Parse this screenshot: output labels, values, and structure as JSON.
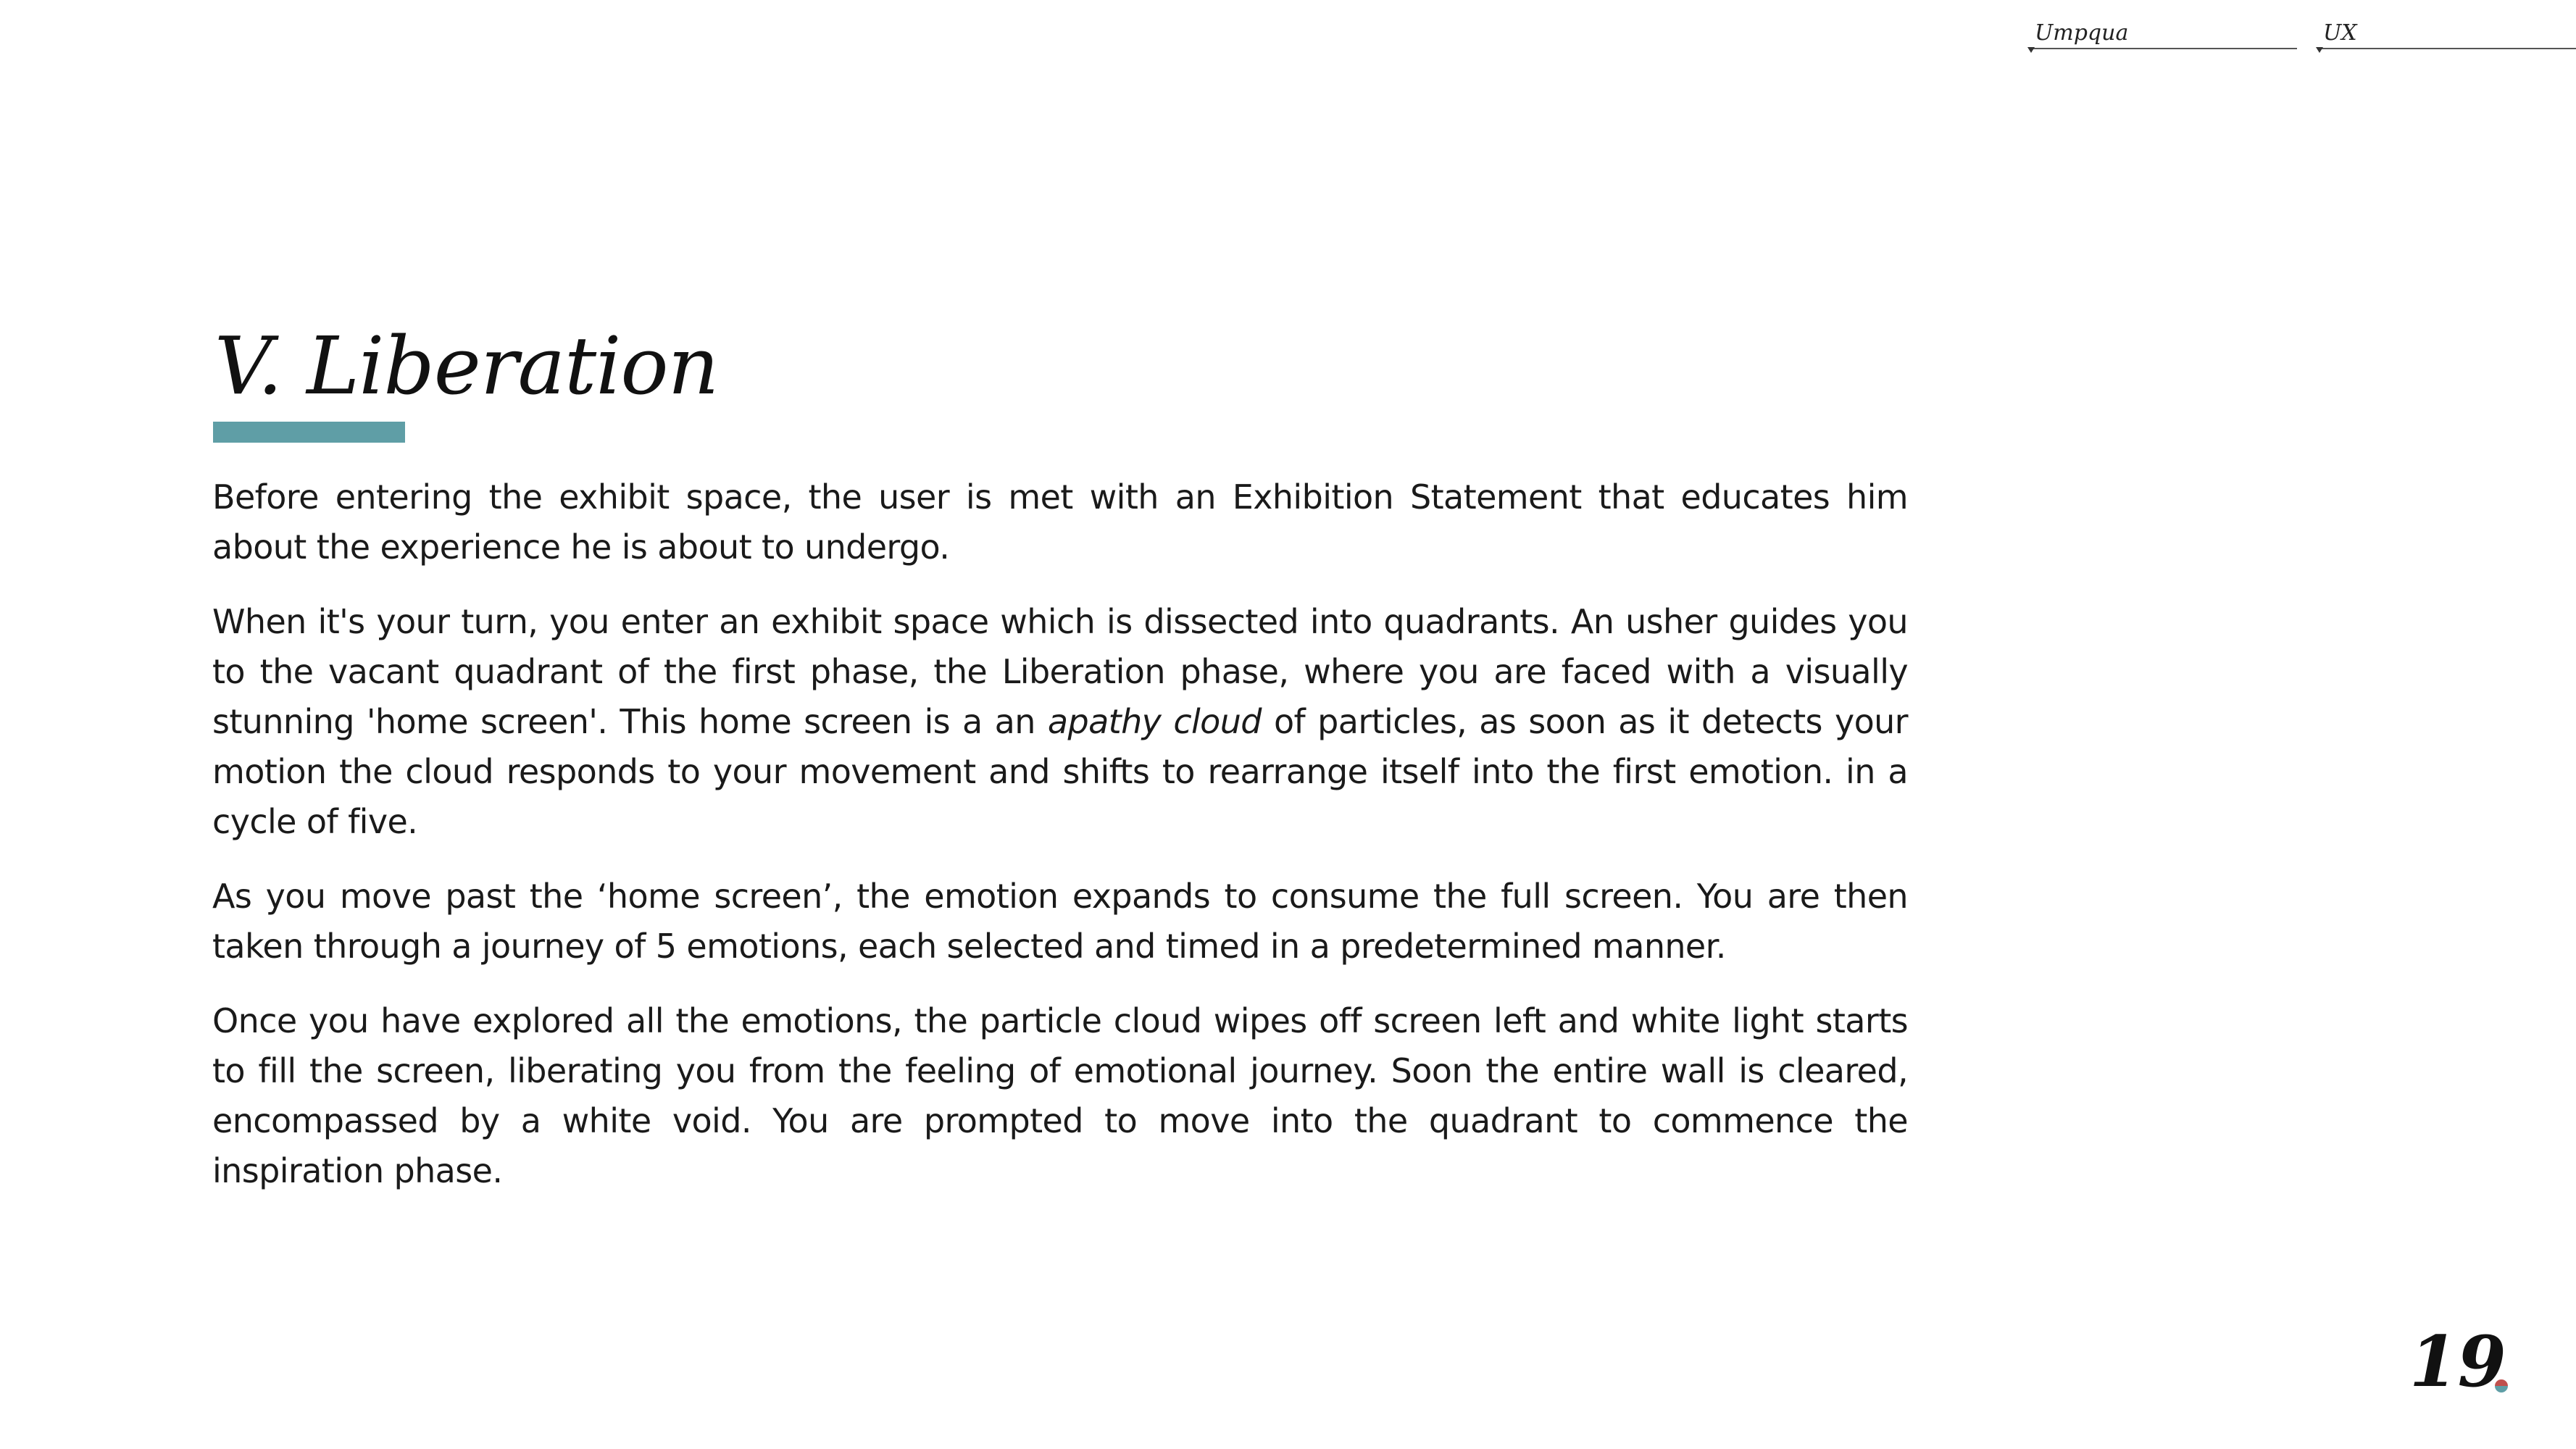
{
  "header": {
    "nav": [
      {
        "label": "Umpqua"
      },
      {
        "label": "UX"
      }
    ]
  },
  "main": {
    "title": "V. Liberation",
    "accent_color": "#5f9ea6",
    "paragraphs": [
      {
        "text": "Before entering the exhibit space, the user is met with an Exhibition Statement that educates him about the experience he is about to undergo."
      },
      {
        "text_before": "When it's your turn, you enter an exhibit space which is dissected into quadrants. An usher guides you to the vacant quadrant of the first phase, the Liberation phase, where you are faced with a visually stunning 'home screen'. This home screen is a an ",
        "emphasis": "apathy cloud",
        "text_after": " of particles, as soon as it detects your motion the cloud responds to your movement and shifts to rearrange itself into the first emotion. in a cycle of five."
      },
      {
        "text": "As you move past the ‘home screen’,  the emotion expands to consume the full screen. You are then taken through a journey of 5 emotions, each selected and timed in a predetermined manner."
      },
      {
        "text": "Once you have explored all the emotions, the particle cloud wipes off screen left and white light starts to fill the screen, liberating you from the feeling of emotional journey. Soon the entire wall is cleared, encompassed by a white void. You are prompted to move into the quadrant to commence the inspiration phase."
      }
    ]
  },
  "footer": {
    "page_number": "19",
    "dot_colors": [
      "#c0504d",
      "#5f9ea6"
    ]
  }
}
